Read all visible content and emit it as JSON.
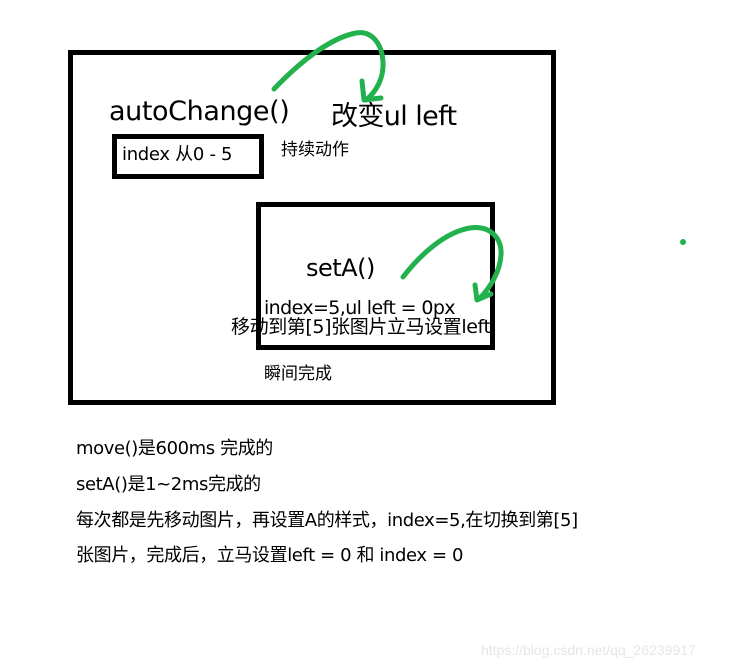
{
  "diagram": {
    "outer_function": {
      "name": "autoChange()",
      "effect": "改变ul left",
      "index_range": "index 从0 - 5",
      "description": "持续动作"
    },
    "inner_function": {
      "name": "setA()",
      "effect_line_1": "index=5,ul left = 0px",
      "effect_line_2": "移动到第[5]张图片立马设置left",
      "description": "瞬间完成"
    },
    "notes": [
      "move()是600ms 完成的",
      "setA()是1~2ms完成的",
      "每次都是先移动图片，再设置A的样式，index=5,在切换到第[5]",
      "张图片，完成后，立马设置left = 0 和 index = 0"
    ],
    "watermark": "https://blog.csdn.net/qq_26239917",
    "colors": {
      "box_border": "#000000",
      "arrow": "#22b14c",
      "text": "#000000",
      "watermark": "#e6e6e6"
    }
  }
}
